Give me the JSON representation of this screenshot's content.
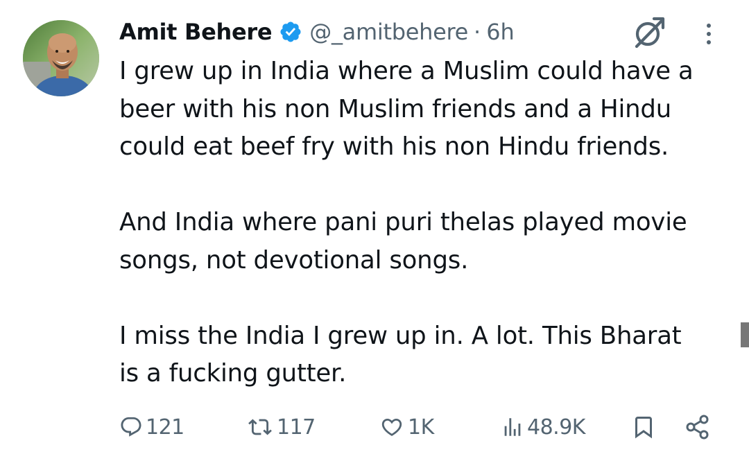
{
  "tweet": {
    "author": {
      "display_name": "Amit Behere",
      "handle": "@_amitbehere",
      "separator": "·",
      "time": "6h",
      "verified": true,
      "avatar_icon": "profile-photo"
    },
    "body": {
      "paragraphs": [
        [
          "I grew up in India where a Muslim could have a",
          "beer with his non Muslim friends and a Hindu",
          "could eat beef fry with his non Hindu friends."
        ],
        [
          "And India where pani puri thelas played movie",
          "songs, not devotional songs."
        ],
        [
          "I miss the India I grew up in. A lot. This Bharat",
          "is a fucking gutter."
        ]
      ]
    },
    "header_icons": [
      "grok-icon",
      "more-options-icon"
    ],
    "actions": {
      "reply": {
        "icon": "reply-icon",
        "count": "121"
      },
      "retweet": {
        "icon": "retweet-icon",
        "count": "117"
      },
      "like": {
        "icon": "heart-icon",
        "count": "1K"
      },
      "views": {
        "icon": "views-icon",
        "count": "48.9K"
      },
      "bookmark": {
        "icon": "bookmark-icon"
      },
      "share": {
        "icon": "share-icon"
      }
    }
  },
  "colors": {
    "text": "#0f1419",
    "secondary": "#536471",
    "verified": "#1d9bf0",
    "background": "#ffffff"
  }
}
